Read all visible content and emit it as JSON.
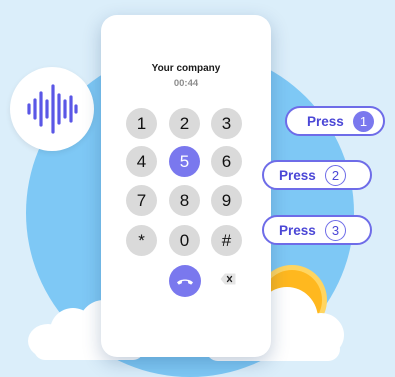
{
  "phone": {
    "company": "Your company",
    "timer": "00:44",
    "keys": [
      "1",
      "2",
      "3",
      "4",
      "5",
      "6",
      "7",
      "8",
      "9",
      "*",
      "0",
      "#"
    ],
    "active_key": "5"
  },
  "press_tags": [
    {
      "label": "Press",
      "number": "1",
      "style": "filled"
    },
    {
      "label": "Press",
      "number": "2",
      "style": "outline"
    },
    {
      "label": "Press",
      "number": "3",
      "style": "outline"
    }
  ],
  "icons": {
    "voice": "sound-wave-icon",
    "call": "phone-hangup-icon",
    "delete": "backspace-icon"
  },
  "colors": {
    "accent": "#7a78ee",
    "sky": "#7ec8f5",
    "background": "#dbeefa",
    "sun": "#ffb81f"
  }
}
